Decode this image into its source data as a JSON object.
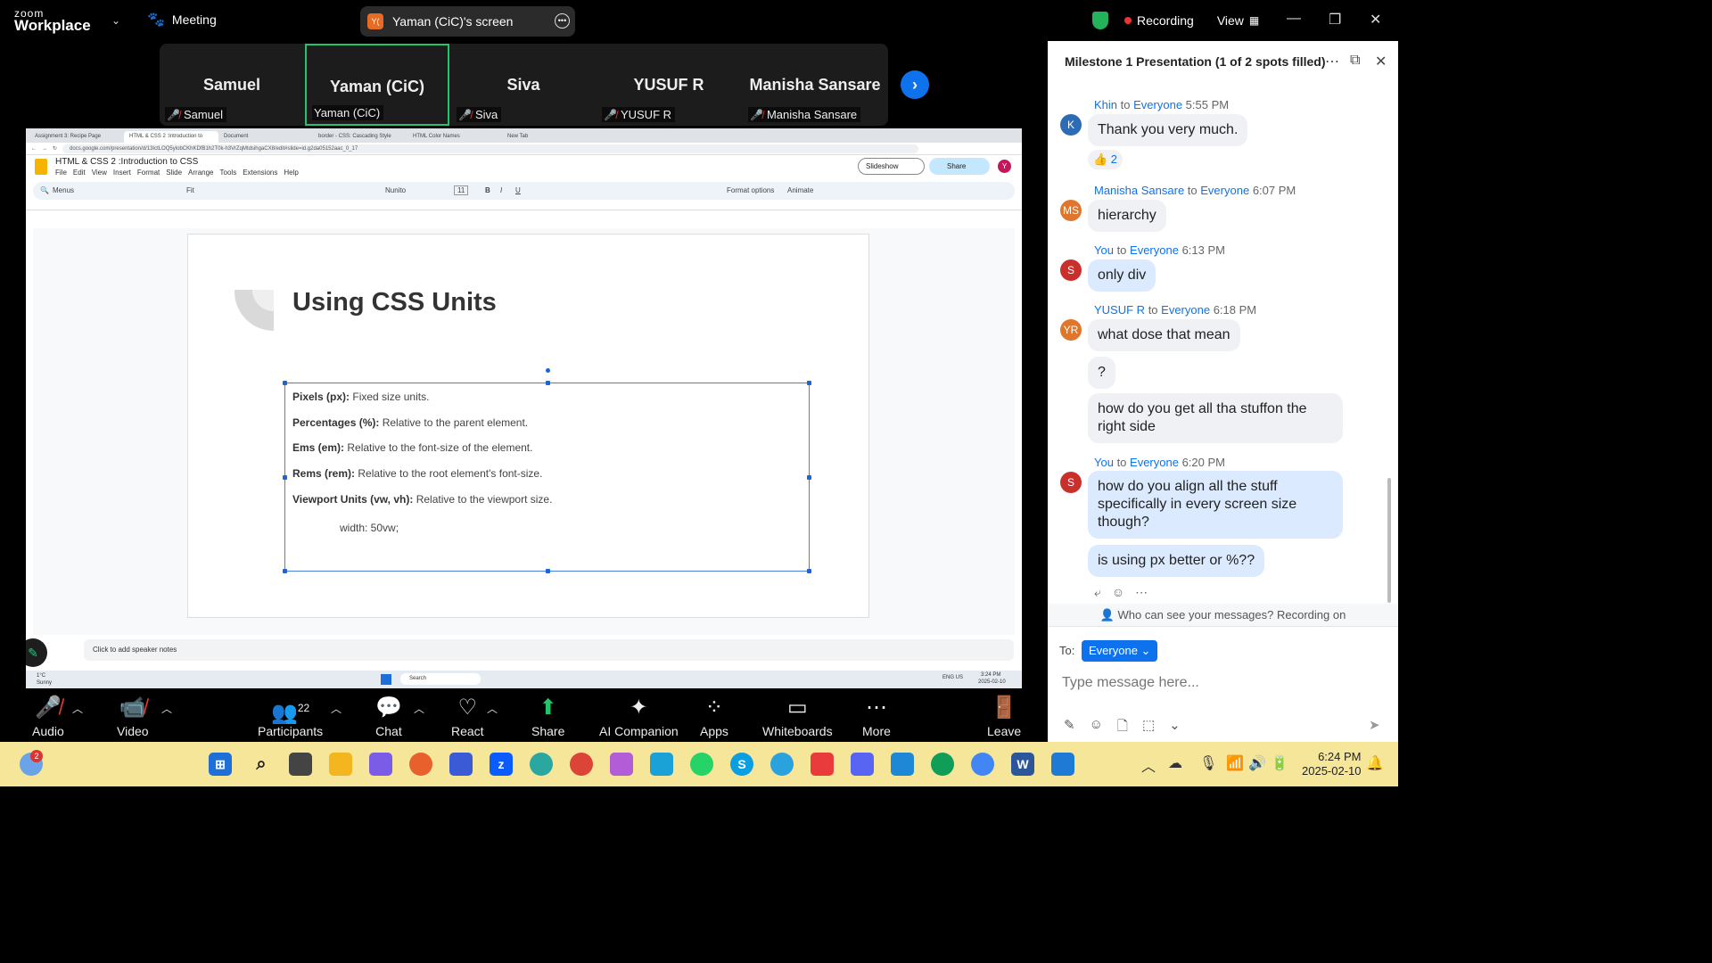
{
  "app": {
    "logo_small": "zoom",
    "logo_big": "Workplace",
    "meeting_label": "Meeting",
    "screen_pill": "Yaman (CiC)'s screen",
    "pill_initials": "Y(",
    "recording": "Recording",
    "view": "View"
  },
  "participants_strip": [
    {
      "name": "Samuel",
      "label": "Samuel"
    },
    {
      "name": "Yaman (CiC)",
      "label": "Yaman (CiC)"
    },
    {
      "name": "Siva",
      "label": "Siva"
    },
    {
      "name": "YUSUF R",
      "label": "YUSUF R"
    },
    {
      "name": "Manisha Sansare",
      "label": "Manisha Sansare"
    }
  ],
  "browser": {
    "tabs": [
      "Assignment 3: Recipe Page",
      "HTML & CSS 2 :Introduction to",
      "Document",
      "border - CSS: Cascading Style",
      "HTML Color Names",
      "New Tab"
    ],
    "url": "docs.google.com/presentation/d/13IctLOQ5ylobCKhKDfB1h2T0k-h3VrZqMtdsihgaCX8/edit#slide=id.g2da05152aac_0_17"
  },
  "slides_app": {
    "doc_title": "HTML & CSS 2 :Introduction to CSS",
    "menu": [
      "File",
      "Edit",
      "View",
      "Insert",
      "Format",
      "Slide",
      "Arrange",
      "Tools",
      "Extensions",
      "Help"
    ],
    "slideshow": "Slideshow",
    "share": "Share",
    "avatar": "Y",
    "toolbar": {
      "menus": "Menus",
      "fit": "Fit",
      "font": "Nunito",
      "size": "11",
      "format_options": "Format options",
      "animate": "Animate"
    },
    "notes_placeholder": "Click to add speaker notes"
  },
  "slide": {
    "title": "Using CSS Units",
    "bullets": [
      {
        "term": "Pixels (px):",
        "desc": " Fixed size units."
      },
      {
        "term": "Percentages (%):",
        "desc": " Relative to the parent element."
      },
      {
        "term": "Ems (em):",
        "desc": " Relative to the font-size of the element."
      },
      {
        "term": "Rems (rem):",
        "desc": " Relative to the root element's font-size."
      },
      {
        "term": "Viewport Units (vw, vh):",
        "desc": " Relative to the viewport size."
      }
    ],
    "code": "width: 50vw;"
  },
  "remote_taskbar": {
    "weather": "1°C",
    "weather_sub": "Sunny",
    "search": "Search",
    "lang": "ENG US",
    "time": "3:24 PM",
    "date": "2025-02-10"
  },
  "bottom_toolbar": {
    "audio": "Audio",
    "video": "Video",
    "participants": "Participants",
    "participants_count": "22",
    "chat": "Chat",
    "react": "React",
    "share": "Share",
    "ai": "AI Companion",
    "apps": "Apps",
    "whiteboards": "Whiteboards",
    "more": "More",
    "leave": "Leave"
  },
  "chat": {
    "title": "Milestone 1 Presentation (1 of 2 spots filled)",
    "messages": [
      {
        "sender": "Khin",
        "to": "Everyone",
        "time": "5:55 PM",
        "initials": "K",
        "text": "Thank you very much.",
        "reaction": "👍 2"
      },
      {
        "sender": "Manisha Sansare",
        "to": "Everyone",
        "time": "6:07 PM",
        "initials": "MS",
        "text": "hierarchy"
      },
      {
        "sender": "You",
        "to": "Everyone",
        "time": "6:13 PM",
        "initials": "S",
        "text": "only div"
      },
      {
        "sender": "YUSUF R",
        "to": "Everyone",
        "time": "6:18 PM",
        "initials": "YR",
        "text": "what dose that mean",
        "text2": "?",
        "text3": "how do you get all tha stuffon the right side"
      },
      {
        "sender": "You",
        "to": "Everyone",
        "time": "6:20 PM",
        "initials": "S",
        "text": "how do you align all the stuff specifically in every screen size though?",
        "text2": "is using px better or %??"
      }
    ],
    "to_word": "to",
    "privacy": "Who can see your messages? Recording on",
    "to_label": "To:",
    "recipient": "Everyone",
    "placeholder": "Type message here..."
  },
  "taskbar": {
    "time": "6:24 PM",
    "date": "2025-02-10",
    "notif": "2"
  },
  "colors": {
    "zoom_blue": "#0e72ed",
    "record_red": "#e33333",
    "active_green": "#23c46c"
  }
}
